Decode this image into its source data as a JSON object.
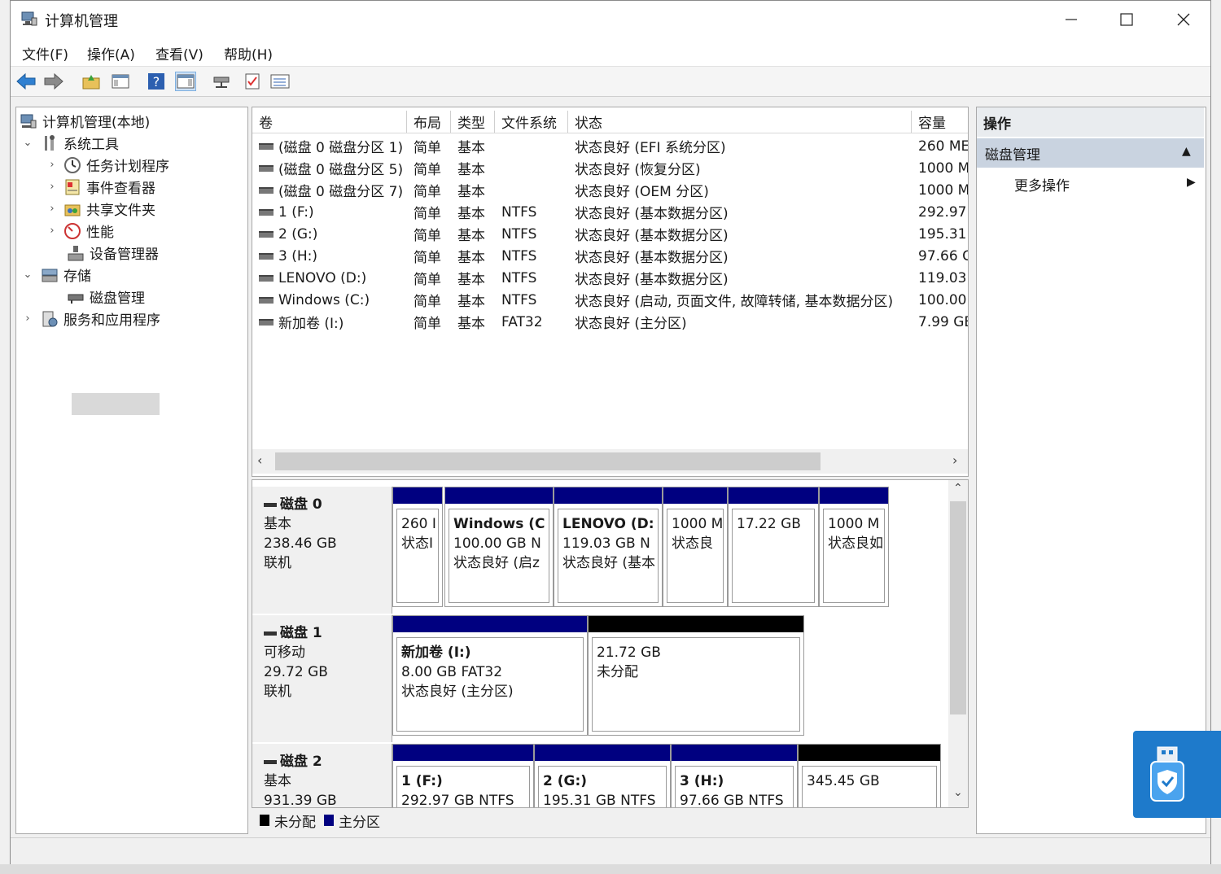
{
  "window": {
    "title": "计算机管理"
  },
  "menu": [
    "文件(F)",
    "操作(A)",
    "查看(V)",
    "帮助(H)"
  ],
  "tree": {
    "root": "计算机管理(本地)",
    "system_tools": "系统工具",
    "task_scheduler": "任务计划程序",
    "event_viewer": "事件查看器",
    "shared_folders": "共享文件夹",
    "performance": "性能",
    "device_manager": "设备管理器",
    "storage": "存储",
    "disk_management": "磁盘管理",
    "services": "服务和应用程序"
  },
  "table": {
    "headers": [
      "卷",
      "布局",
      "类型",
      "文件系统",
      "状态",
      "容量"
    ],
    "rows": [
      {
        "vol": "(磁盘 0 磁盘分区 1)",
        "layout": "简单",
        "type": "基本",
        "fs": "",
        "status": "状态良好 (EFI 系统分区)",
        "cap": "260 ME"
      },
      {
        "vol": "(磁盘 0 磁盘分区 5)",
        "layout": "简单",
        "type": "基本",
        "fs": "",
        "status": "状态良好 (恢复分区)",
        "cap": "1000 M"
      },
      {
        "vol": "(磁盘 0 磁盘分区 7)",
        "layout": "简单",
        "type": "基本",
        "fs": "",
        "status": "状态良好 (OEM 分区)",
        "cap": "1000 M"
      },
      {
        "vol": "1 (F:)",
        "layout": "简单",
        "type": "基本",
        "fs": "NTFS",
        "status": "状态良好 (基本数据分区)",
        "cap": "292.97"
      },
      {
        "vol": "2 (G:)",
        "layout": "简单",
        "type": "基本",
        "fs": "NTFS",
        "status": "状态良好 (基本数据分区)",
        "cap": "195.31"
      },
      {
        "vol": "3 (H:)",
        "layout": "简单",
        "type": "基本",
        "fs": "NTFS",
        "status": "状态良好 (基本数据分区)",
        "cap": "97.66 G"
      },
      {
        "vol": "LENOVO (D:)",
        "layout": "简单",
        "type": "基本",
        "fs": "NTFS",
        "status": "状态良好 (基本数据分区)",
        "cap": "119.03"
      },
      {
        "vol": "Windows (C:)",
        "layout": "简单",
        "type": "基本",
        "fs": "NTFS",
        "status": "状态良好 (启动, 页面文件, 故障转储, 基本数据分区)",
        "cap": "100.00"
      },
      {
        "vol": "新加卷 (I:)",
        "layout": "简单",
        "type": "基本",
        "fs": "FAT32",
        "status": "状态良好 (主分区)",
        "cap": "7.99 GE"
      }
    ]
  },
  "disks": [
    {
      "name": "磁盘 0",
      "kind": "基本",
      "size": "238.46 GB",
      "state": "联机",
      "parts": [
        {
          "title": "",
          "line1": "260 I",
          "line2": "状态I"
        },
        {
          "title": "Windows (C",
          "line1": "100.00 GB N",
          "line2": "状态良好 (启z"
        },
        {
          "title": "LENOVO (D:",
          "line1": "119.03 GB N",
          "line2": "状态良好 (基本"
        },
        {
          "title": "",
          "line1": "1000 M",
          "line2": "状态良"
        },
        {
          "title": "",
          "line1": "17.22 GB",
          "line2": ""
        },
        {
          "title": "",
          "line1": "1000 M",
          "line2": "状态良如"
        }
      ]
    },
    {
      "name": "磁盘 1",
      "kind": "可移动",
      "size": "29.72 GB",
      "state": "联机",
      "parts": [
        {
          "title": "新加卷 (I:)",
          "line1": "8.00 GB FAT32",
          "line2": "状态良好 (主分区)"
        },
        {
          "title": "",
          "line1": "21.72 GB",
          "line2": "未分配"
        }
      ]
    },
    {
      "name": "磁盘 2",
      "kind": "基本",
      "size": "931.39 GB",
      "state": "",
      "parts": [
        {
          "title": "1 (F:)",
          "line1": "292.97 GB NTFS",
          "line2": ""
        },
        {
          "title": "2 (G:)",
          "line1": "195.31 GB NTFS",
          "line2": ""
        },
        {
          "title": "3 (H:)",
          "line1": "97.66 GB NTFS",
          "line2": ""
        },
        {
          "title": "",
          "line1": "345.45 GB",
          "line2": ""
        }
      ]
    }
  ],
  "legend": {
    "unallocated": "未分配",
    "primary": "主分区"
  },
  "actions": {
    "title": "操作",
    "section": "磁盘管理",
    "more": "更多操作"
  },
  "colors": {
    "primary_bar": "#000080",
    "unallocated_bar": "#000000",
    "selection": "#c9d3e0"
  }
}
